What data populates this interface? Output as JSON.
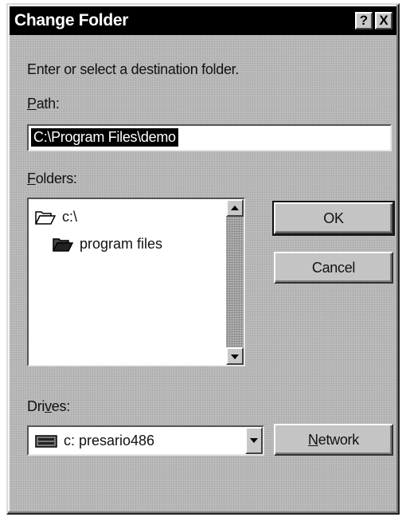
{
  "window": {
    "title": "Change Folder",
    "help_button": "?",
    "close_button": "X"
  },
  "instructions": "Enter or select a destination folder.",
  "path": {
    "label_accel": "P",
    "label_rest": "ath:",
    "value": "C:\\Program Files\\demo"
  },
  "folders": {
    "label_accel": "F",
    "label_rest": "olders:",
    "items": [
      {
        "name": "c:\\",
        "icon": "open-folder-icon"
      },
      {
        "name": "program files",
        "icon": "open-folder-icon"
      }
    ]
  },
  "buttons": {
    "ok": "OK",
    "cancel": "Cancel",
    "network_accel": "N",
    "network_rest": "etwork"
  },
  "drives": {
    "label_pre": "Dri",
    "label_accel": "v",
    "label_post": "es:",
    "selected": "c: presario486",
    "icon": "hard-drive-icon"
  }
}
